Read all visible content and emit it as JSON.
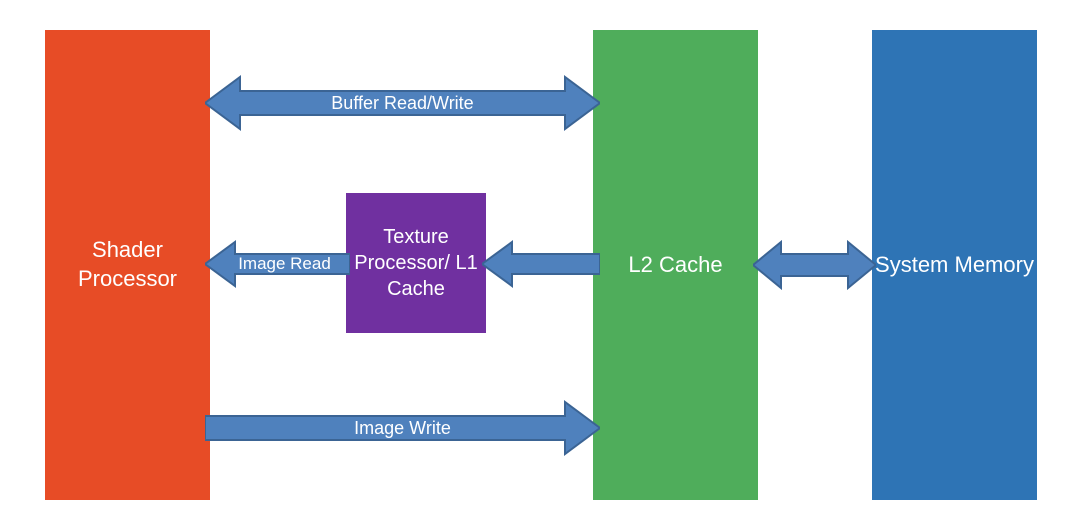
{
  "boxes": {
    "shader": "Shader Processor",
    "texture": "Texture Processor/ L1 Cache",
    "l2": "L2 Cache",
    "memory": "System Memory"
  },
  "arrows": {
    "buffer_rw": "Buffer Read/Write",
    "image_read": "Image Read",
    "image_write": "Image Write",
    "tex_to_l2": "",
    "l2_to_mem": ""
  },
  "colors": {
    "shader": "#E74C26",
    "texture": "#7030A0",
    "l2": "#4FAD5B",
    "memory": "#2E74B5",
    "arrow_fill": "#4F81BD",
    "arrow_stroke": "#3B6494"
  }
}
